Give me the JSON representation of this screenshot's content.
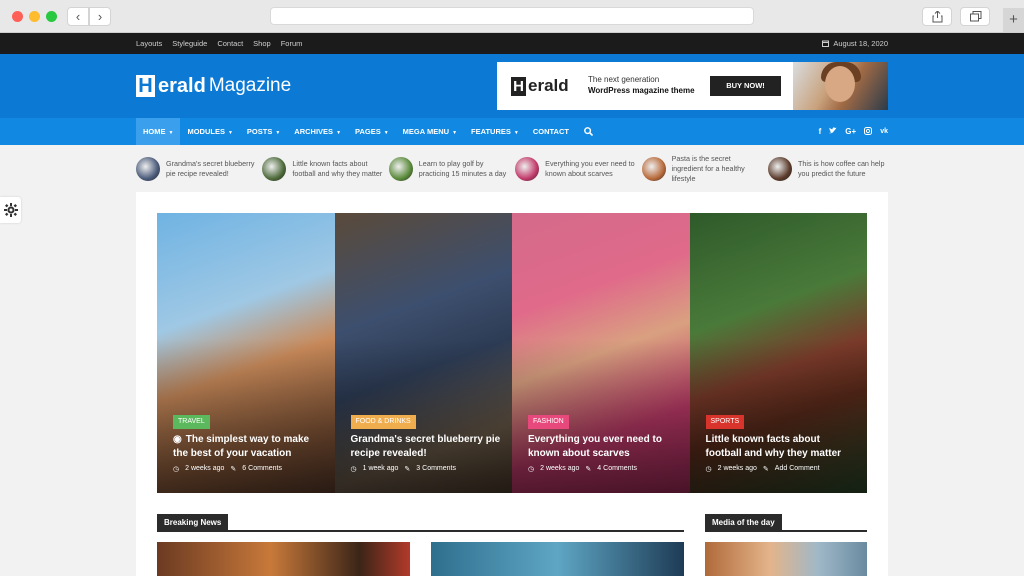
{
  "topbar": {
    "links": [
      "Layouts",
      "Styleguide",
      "Contact",
      "Shop",
      "Forum"
    ],
    "date": "August 18, 2020",
    "date_icon": "calendar-icon"
  },
  "logo": {
    "letter": "H",
    "bold": "erald",
    "thin": "Magazine"
  },
  "ad": {
    "logo_letter": "H",
    "logo_word": "erald",
    "tagline1": "The next generation",
    "tagline2": "WordPress magazine theme",
    "cta": "BUY NOW!"
  },
  "nav": {
    "items": [
      {
        "label": "HOME",
        "dropdown": true,
        "active": true
      },
      {
        "label": "MODULES",
        "dropdown": true
      },
      {
        "label": "POSTS",
        "dropdown": true
      },
      {
        "label": "ARCHIVES",
        "dropdown": true
      },
      {
        "label": "PAGES",
        "dropdown": true
      },
      {
        "label": "MEGA MENU",
        "dropdown": true
      },
      {
        "label": "FEATURES",
        "dropdown": true
      },
      {
        "label": "CONTACT",
        "dropdown": false
      }
    ],
    "social": [
      "f",
      "t",
      "G+",
      "ig",
      "vk"
    ],
    "accent": "#1189e3",
    "header_color": "#0c7ad4"
  },
  "ticker": [
    {
      "text": "Grandma's secret blueberry pie recipe revealed!",
      "color": "#4a5a7a"
    },
    {
      "text": "Little known facts about football and why they matter",
      "color": "#4d6a3a"
    },
    {
      "text": "Learn to play golf by practicing 15 minutes a day",
      "color": "#5a8a3a"
    },
    {
      "text": "Everything you ever need to known about scarves",
      "color": "#c23a6a"
    },
    {
      "text": "Pasta is the secret ingredient for a healthy lifestyle",
      "color": "#b86a3a"
    },
    {
      "text": "This is how coffee can help you predict the future",
      "color": "#5a3a2a"
    }
  ],
  "featured": [
    {
      "category": "TRAVEL",
      "cat_color": "#5cb85c",
      "camera": true,
      "title": "The simplest way to make the best of your vacation",
      "time": "2 weeks ago",
      "comments": "6 Comments"
    },
    {
      "category": "FOOD & DRINKS",
      "cat_color": "#f0ad4e",
      "camera": false,
      "title": "Grandma's secret blueberry pie recipe revealed!",
      "time": "1 week ago",
      "comments": "3 Comments"
    },
    {
      "category": "FASHION",
      "cat_color": "#e8497c",
      "camera": false,
      "title": "Everything you ever need to known about scarves",
      "time": "2 weeks ago",
      "comments": "4 Comments"
    },
    {
      "category": "SPORTS",
      "cat_color": "#d9342b",
      "camera": false,
      "title": "Little known facts about football and why they matter",
      "time": "2 weeks ago",
      "comments": "Add Comment"
    }
  ],
  "sections": {
    "breaking": "Breaking News",
    "media": "Media of the day"
  }
}
